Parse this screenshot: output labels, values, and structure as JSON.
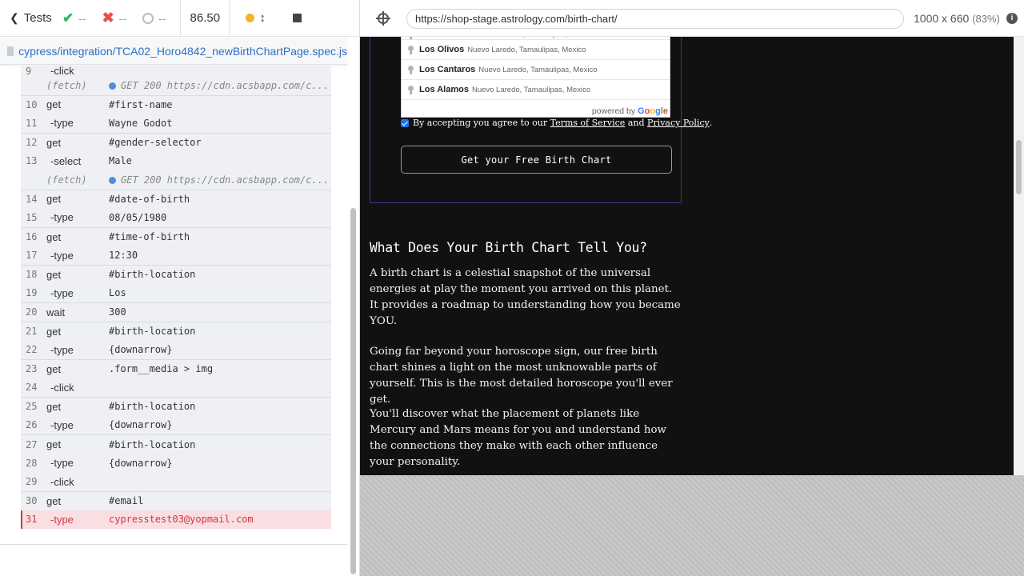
{
  "reporter": {
    "tests_label": "Tests",
    "passed": "--",
    "failed": "--",
    "pending": "--",
    "duration": "86.50",
    "spec_path": "cypress/integration/TCA02_Horo4842_newBirthChartPage.spec.js"
  },
  "commands": [
    {
      "num": "9",
      "name": "-click",
      "msg": "",
      "child": true,
      "partial": true
    },
    {
      "num": "",
      "name": "(fetch)",
      "msg": "GET 200 https://cdn.acsbapp.com/c...",
      "fetch": true
    },
    {
      "num": "10",
      "name": "get",
      "msg": "#first-name",
      "sep": true
    },
    {
      "num": "11",
      "name": "-type",
      "msg": "Wayne Godot",
      "child": true
    },
    {
      "num": "12",
      "name": "get",
      "msg": "#gender-selector",
      "sep": true
    },
    {
      "num": "13",
      "name": "-select",
      "msg": "Male",
      "child": true
    },
    {
      "num": "",
      "name": "(fetch)",
      "msg": "GET 200 https://cdn.acsbapp.com/c...",
      "fetch": true
    },
    {
      "num": "14",
      "name": "get",
      "msg": "#date-of-birth",
      "sep": true
    },
    {
      "num": "15",
      "name": "-type",
      "msg": "08/05/1980",
      "child": true
    },
    {
      "num": "16",
      "name": "get",
      "msg": "#time-of-birth",
      "sep": true
    },
    {
      "num": "17",
      "name": "-type",
      "msg": "12:30",
      "child": true
    },
    {
      "num": "18",
      "name": "get",
      "msg": "#birth-location",
      "sep": true
    },
    {
      "num": "19",
      "name": "-type",
      "msg": "Los",
      "child": true
    },
    {
      "num": "20",
      "name": "wait",
      "msg": "300",
      "sep": true
    },
    {
      "num": "21",
      "name": "get",
      "msg": "#birth-location",
      "sep": true
    },
    {
      "num": "22",
      "name": "-type",
      "msg": "{downarrow}",
      "child": true
    },
    {
      "num": "23",
      "name": "get",
      "msg": ".form__media > img",
      "sep": true
    },
    {
      "num": "24",
      "name": "-click",
      "msg": "",
      "child": true
    },
    {
      "num": "25",
      "name": "get",
      "msg": "#birth-location",
      "sep": true
    },
    {
      "num": "26",
      "name": "-type",
      "msg": "{downarrow}",
      "child": true
    },
    {
      "num": "27",
      "name": "get",
      "msg": "#birth-location",
      "sep": true
    },
    {
      "num": "28",
      "name": "-type",
      "msg": "{downarrow}",
      "child": true
    },
    {
      "num": "29",
      "name": "-click",
      "msg": "",
      "child": true
    },
    {
      "num": "30",
      "name": "get",
      "msg": "#email",
      "sep": true
    },
    {
      "num": "31",
      "name": "-type",
      "msg": "cypresstest03@yopmail.com",
      "child": true,
      "error": true
    }
  ],
  "aut_header": {
    "url": "https://shop-stage.astrology.com/birth-chart/",
    "viewport": "1000 x 660",
    "scale": "(83%)",
    "info_glyph": "i"
  },
  "autocomplete": {
    "items": [
      {
        "main": "Los Encinos",
        "secondary": "Nuevo Laredo, Tamaulipas, Mexico"
      },
      {
        "main": "Los Olivos",
        "secondary": "Nuevo Laredo, Tamaulipas, Mexico"
      },
      {
        "main": "Los Cantaros",
        "secondary": "Nuevo Laredo, Tamaulipas, Mexico"
      },
      {
        "main": "Los Alamos",
        "secondary": "Nuevo Laredo, Tamaulipas, Mexico"
      }
    ],
    "footer_prefix": "powered by",
    "footer_brand": [
      "G",
      "o",
      "o",
      "g",
      "l",
      "e"
    ]
  },
  "form": {
    "terms_prefix": "By accepting you agree to our ",
    "terms_link": "Terms of Service",
    "terms_and": " and ",
    "privacy_link": "Privacy Policy",
    "terms_suffix": ".",
    "cta_label": "Get your Free Birth Chart"
  },
  "content": {
    "heading": "What Does Your Birth Chart Tell You?",
    "paragraphs": [
      "A birth chart is a celestial snapshot of the universal energies at play the moment you arrived on this planet. It provides a roadmap to understanding how you became YOU.",
      "Going far beyond your horoscope sign, our free birth chart shines a light on the most unknowable parts of yourself. This is the most detailed horoscope you'll ever get.",
      "You'll discover what the placement of planets like Mercury and Mars means for you and understand how the connections they make with each other influence your personality."
    ]
  }
}
